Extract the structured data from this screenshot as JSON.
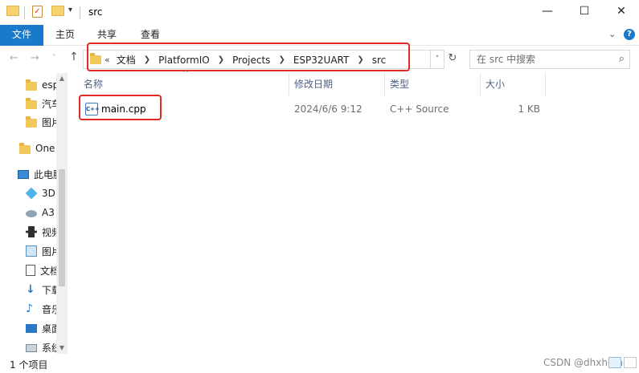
{
  "window": {
    "title": "src",
    "controls": [
      "—",
      "☐",
      "✕"
    ]
  },
  "ribbon": {
    "tabs": [
      "文件",
      "主页",
      "共享",
      "查看"
    ],
    "expand_icon": "chevron-down-icon",
    "help_icon": "help-icon"
  },
  "nav": {
    "back_icon": "←",
    "forward_icon": "→",
    "recent_icon": "˅",
    "up_icon": "↑",
    "breadcrumb_prefix": "«",
    "breadcrumbs": [
      "文档",
      "PlatformIO",
      "Projects",
      "ESP32UART",
      "src"
    ],
    "dropdown_icon": "˅",
    "refresh_icon": "↻"
  },
  "search": {
    "placeholder": "在 src 中搜索",
    "icon": "search-icon"
  },
  "sidebar": {
    "items": [
      {
        "label": "esp",
        "icon": "folder-icon"
      },
      {
        "label": "汽车",
        "icon": "folder-icon"
      },
      {
        "label": "图片",
        "icon": "folder-icon"
      },
      {
        "label": "One",
        "icon": "onedrive-folder-icon"
      },
      {
        "label": "此电脑",
        "icon": "computer-icon"
      },
      {
        "label": "3D",
        "icon": "3d-objects-icon"
      },
      {
        "label": "A3",
        "icon": "network-drive-icon"
      },
      {
        "label": "视频",
        "icon": "video-icon"
      },
      {
        "label": "图片",
        "icon": "pictures-icon"
      },
      {
        "label": "文档",
        "icon": "documents-icon"
      },
      {
        "label": "下载",
        "icon": "download-icon"
      },
      {
        "label": "音乐",
        "icon": "music-icon"
      },
      {
        "label": "桌面",
        "icon": "desktop-icon"
      },
      {
        "label": "系统",
        "icon": "system-drive-icon"
      }
    ]
  },
  "file_list": {
    "columns": [
      "名称",
      "修改日期",
      "类型",
      "大小"
    ],
    "rows": [
      {
        "name": "main.cpp",
        "modified": "2024/6/6 9:12",
        "type": "C++ Source",
        "size": "1 KB",
        "icon": "cpp-file-icon"
      }
    ]
  },
  "status": {
    "item_count": "1 个项目",
    "watermark": "CSDN @dhxhome"
  },
  "colors": {
    "accent": "#1979ca",
    "highlight_border": "#e22a22",
    "header_text": "#4d6082"
  }
}
